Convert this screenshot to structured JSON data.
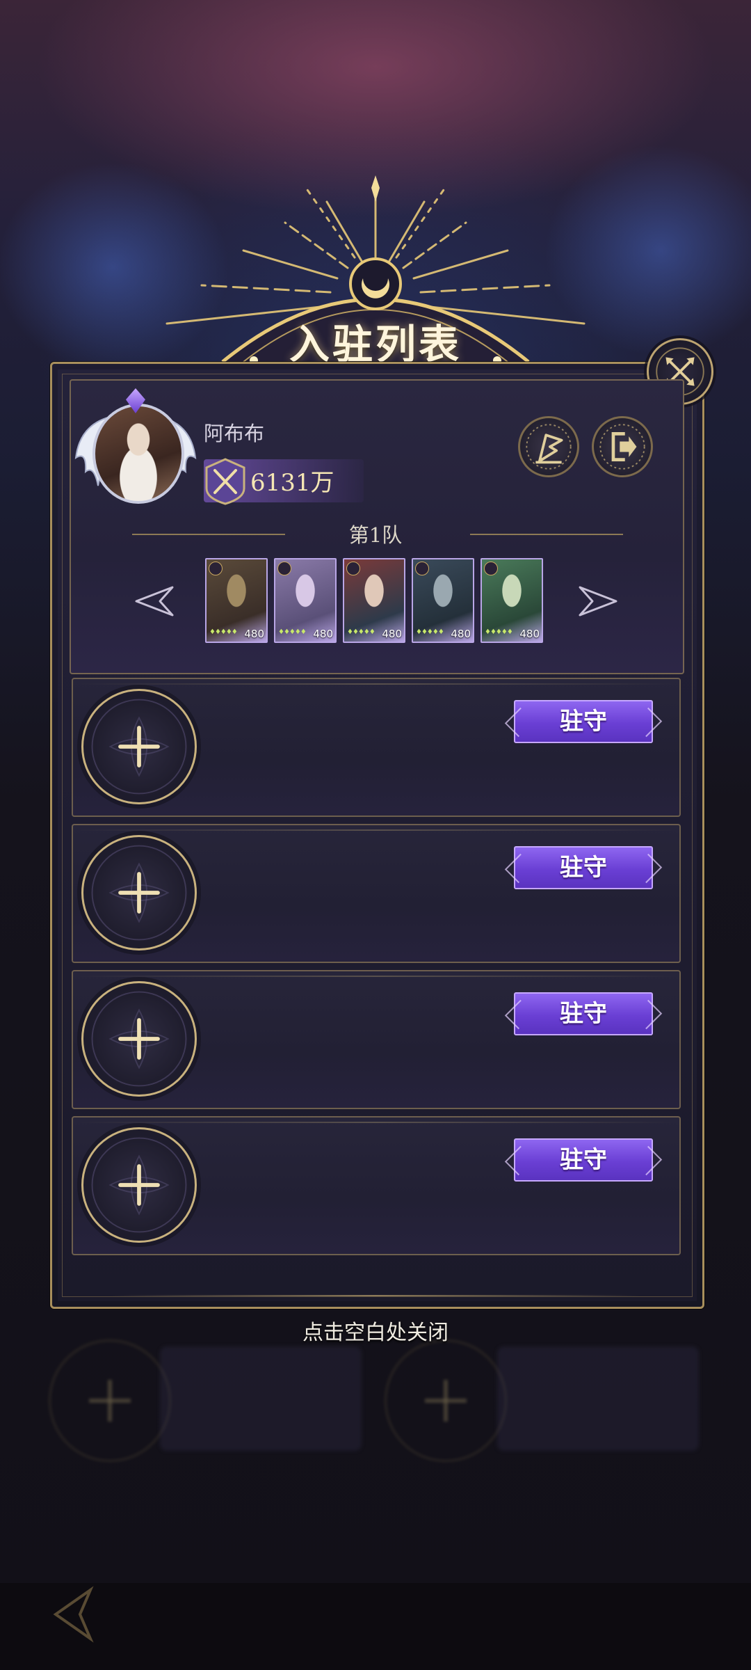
{
  "dialog": {
    "title": "入驻列表",
    "close_hint": "点击空白处关闭"
  },
  "player": {
    "name": "阿布布",
    "power": "6131万"
  },
  "team": {
    "label": "第1队",
    "heroes": [
      {
        "level": "480",
        "palette": [
          "#5a4a3a",
          "#a08a62",
          "#3a2e28"
        ],
        "element": "gold"
      },
      {
        "level": "480",
        "palette": [
          "#8a7aa8",
          "#d8c8e6",
          "#5a5078"
        ],
        "element": "silver"
      },
      {
        "level": "480",
        "palette": [
          "#7a3a3a",
          "#e0c8b8",
          "#2e3a4a"
        ],
        "element": "red"
      },
      {
        "level": "480",
        "palette": [
          "#3a4a5a",
          "#9aa8b0",
          "#24303a"
        ],
        "element": "gold"
      },
      {
        "level": "480",
        "palette": [
          "#4a7a5a",
          "#c8d8b8",
          "#2a4838"
        ],
        "element": "green"
      }
    ]
  },
  "slots": [
    {
      "button_label": "驻守"
    },
    {
      "button_label": "驻守"
    },
    {
      "button_label": "驻守"
    },
    {
      "button_label": "驻守"
    }
  ],
  "icons": {
    "close": "close-x-icon",
    "flag": "flag-icon",
    "exit": "exit-icon",
    "power": "crossed-swords-icon",
    "add": "plus-icon",
    "prev": "arrow-left-icon",
    "next": "arrow-right-icon"
  },
  "colors": {
    "gold": "#c9b27e",
    "purple_button": "#6a3fd4",
    "panel": "#211f33"
  }
}
